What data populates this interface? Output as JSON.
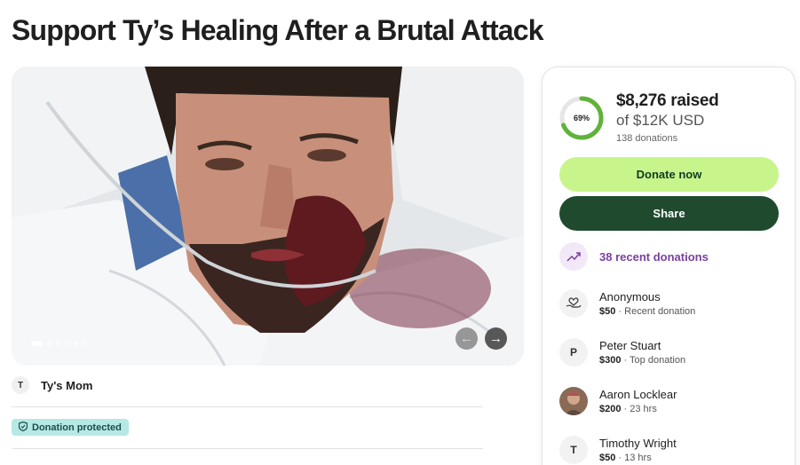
{
  "campaign": {
    "title": "Support Ty’s Healing After a Brutal Attack",
    "organizer_initial": "T",
    "organizer_name": "Ty's Mom",
    "protected_label": "Donation protected"
  },
  "carousel": {
    "image_icon": "campaign-photo",
    "slide_count": 6,
    "active_slide": 1,
    "prev_icon": "arrow-left-icon",
    "next_icon": "arrow-right-icon"
  },
  "progress": {
    "percent": 69,
    "percent_label": "69%",
    "raised": "$8,276 raised",
    "goal": "of $12K USD",
    "donation_count": "138 donations",
    "ring_color": "#60b33a",
    "ring_track_color": "#e6e6e6"
  },
  "actions": {
    "donate_label": "Donate now",
    "share_label": "Share",
    "donate_color": "#c8f58b",
    "share_color": "#1f4a2e"
  },
  "recent": {
    "label": "38 recent donations",
    "icon": "trending-up-icon",
    "color": "#7b3fa0"
  },
  "donors": [
    {
      "name": "Anonymous",
      "amount": "$50",
      "detail": " · Recent donation",
      "avatar": "heart-hand-icon",
      "initial": ""
    },
    {
      "name": "Peter Stuart",
      "amount": "$300",
      "detail": " · Top donation",
      "avatar": "initial",
      "initial": "P"
    },
    {
      "name": "Aaron Locklear",
      "amount": "$200",
      "detail": " · 23 hrs",
      "avatar": "photo",
      "initial": ""
    },
    {
      "name": "Timothy Wright",
      "amount": "$50",
      "detail": " · 13 hrs",
      "avatar": "initial",
      "initial": "T"
    }
  ]
}
